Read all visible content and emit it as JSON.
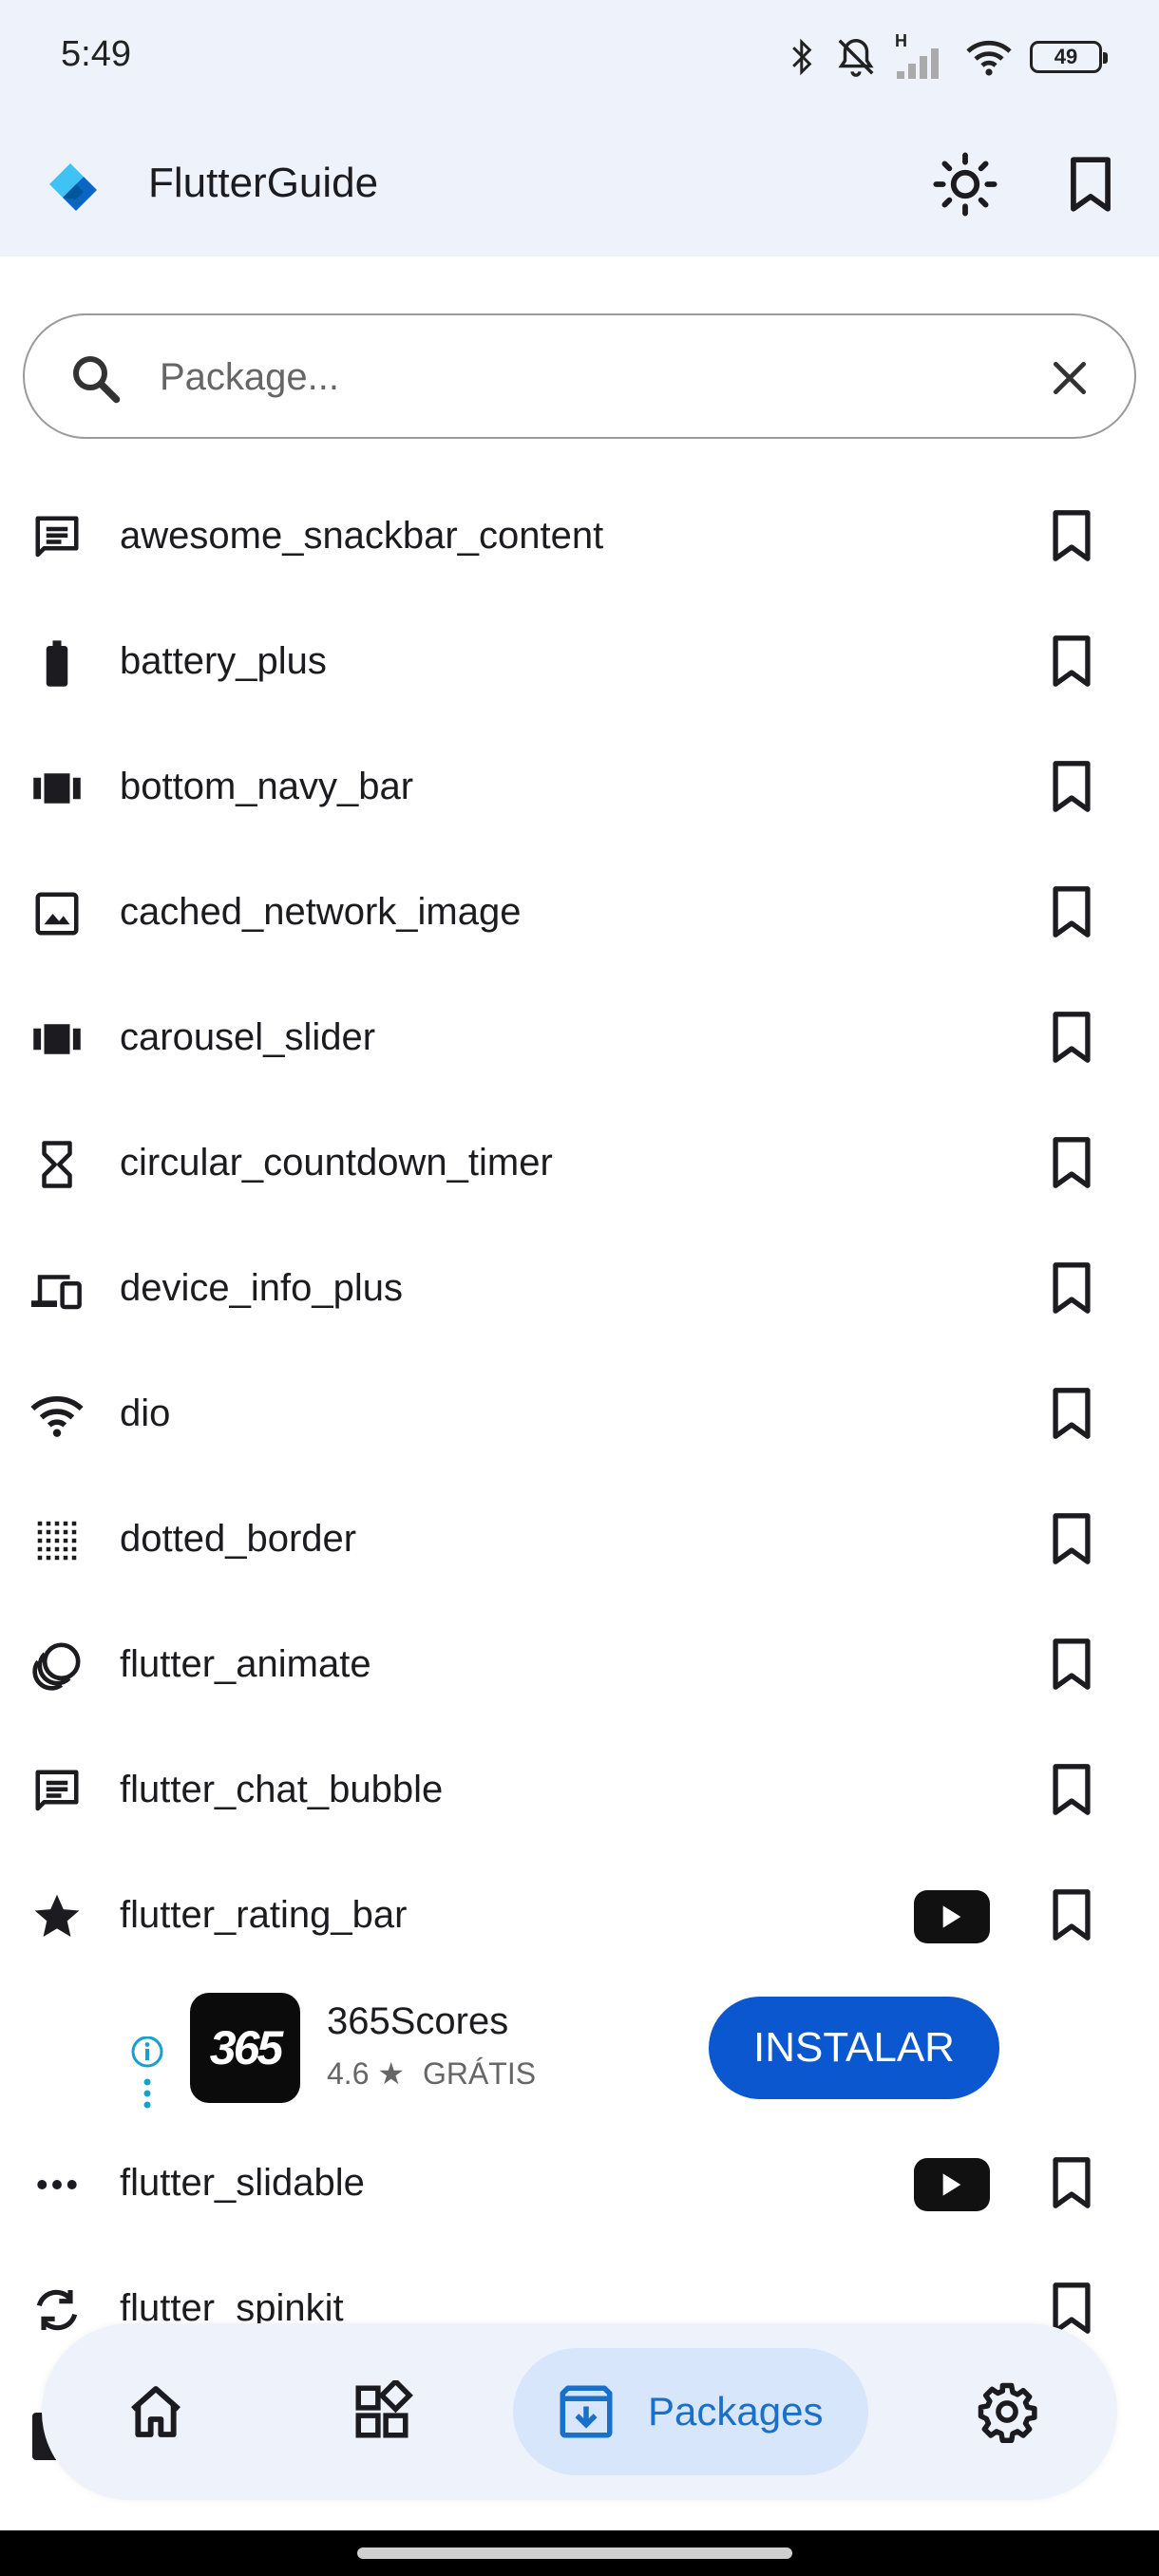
{
  "status_bar": {
    "time": "5:49",
    "network_type": "H",
    "battery": "49"
  },
  "app_bar": {
    "title": "FlutterGuide",
    "logo_icon": "flutter-diamond-logo",
    "actions": [
      "brightness-icon",
      "bookmark-icon"
    ]
  },
  "search": {
    "placeholder": "Package...",
    "value": ""
  },
  "packages": [
    {
      "name": "awesome_snackbar_content",
      "icon": "chat-icon",
      "has_video": false
    },
    {
      "name": "battery_plus",
      "icon": "battery-icon",
      "has_video": false
    },
    {
      "name": "bottom_navy_bar",
      "icon": "carousel-icon",
      "has_video": false
    },
    {
      "name": "cached_network_image",
      "icon": "image-icon",
      "has_video": false
    },
    {
      "name": "carousel_slider",
      "icon": "carousel-icon",
      "has_video": false
    },
    {
      "name": "circular_countdown_timer",
      "icon": "hourglass-icon",
      "has_video": false
    },
    {
      "name": "device_info_plus",
      "icon": "devices-icon",
      "has_video": false
    },
    {
      "name": "dio",
      "icon": "wifi-icon",
      "has_video": false
    },
    {
      "name": "dotted_border",
      "icon": "dotted-border-icon",
      "has_video": false
    },
    {
      "name": "flutter_animate",
      "icon": "animation-icon",
      "has_video": false
    },
    {
      "name": "flutter_chat_bubble",
      "icon": "chat-icon",
      "has_video": false
    },
    {
      "name": "flutter_rating_bar",
      "icon": "star-icon",
      "has_video": true
    },
    {
      "name": "flutter_slidable",
      "icon": "more-horiz-icon",
      "has_video": true
    },
    {
      "name": "flutter_spinkit",
      "icon": "sync-icon",
      "has_video": false
    }
  ],
  "ad": {
    "app_name": "365Scores",
    "logo_text": "365",
    "rating": "4.6",
    "price": "GRÁTIS",
    "install_label": "INSTALAR"
  },
  "bottom_nav": {
    "items": [
      {
        "icon": "home-icon",
        "label": ""
      },
      {
        "icon": "widgets-icon",
        "label": ""
      },
      {
        "icon": "packages-icon",
        "label": "Packages",
        "active": true
      },
      {
        "icon": "settings-icon",
        "label": ""
      }
    ]
  },
  "colors": {
    "surface": "#eef3fb",
    "active_indicator": "#d7e6fb",
    "accent": "#1a6fc9",
    "install_button": "#0b57d0"
  }
}
